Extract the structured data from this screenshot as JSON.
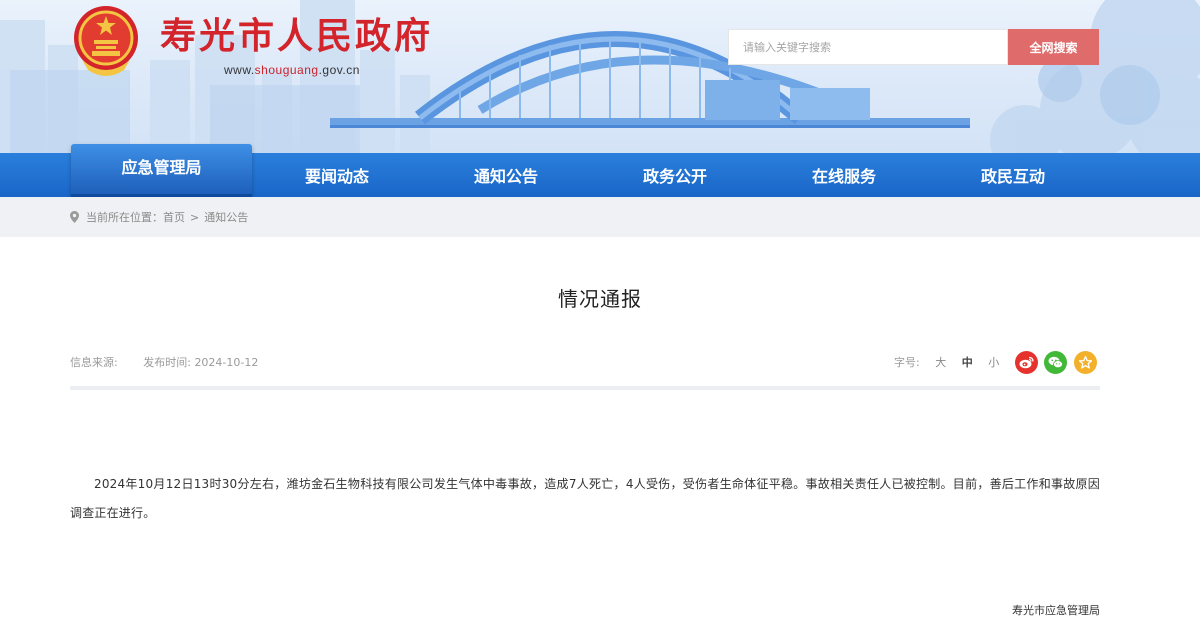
{
  "header": {
    "site_title": "寿光市人民政府",
    "site_url_prefix": "www.",
    "site_url_highlight": "shouguang",
    "site_url_suffix": ".gov.cn",
    "search_placeholder": "请输入关键字搜索",
    "search_button": "全网搜索"
  },
  "nav": {
    "items": [
      "应急管理局",
      "要闻动态",
      "通知公告",
      "政务公开",
      "在线服务",
      "政民互动"
    ],
    "active": "应急管理局"
  },
  "breadcrumb": {
    "label": "当前所在位置：",
    "home": "首页",
    "separator": ">",
    "current": "通知公告"
  },
  "article": {
    "title": "情况通报",
    "source_label": "信息来源:",
    "date_label": "发布时间:",
    "date": "2024-10-12",
    "fontsize_label": "字号:",
    "fontsize_large": "大",
    "fontsize_medium": "中",
    "fontsize_small": "小",
    "body": "2024年10月12日13时30分左右，潍坊金石生物科技有限公司发生气体中毒事故，造成7人死亡，4人受伤，受伤者生命体征平稳。事故相关责任人已被控制。目前，善后工作和事故原因调查正在进行。",
    "signature": "寿光市应急管理局"
  },
  "share_icons": [
    "weibo-icon",
    "wechat-icon",
    "favorite-star-icon"
  ],
  "colors": {
    "brand_red": "#d2242a",
    "nav_blue": "#1a66c8",
    "search_button": "#df6b6b"
  }
}
